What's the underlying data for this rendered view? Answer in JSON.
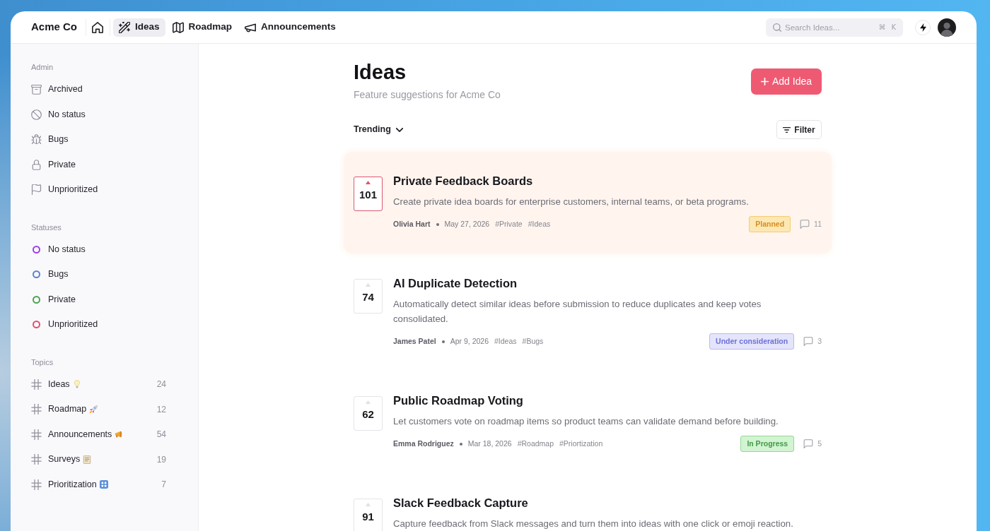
{
  "topbar": {
    "brand": "Acme Co",
    "tabs": [
      {
        "label": "Ideas",
        "selected": true
      },
      {
        "label": "Roadmap",
        "selected": false
      },
      {
        "label": "Announcements",
        "selected": false
      }
    ],
    "search": {
      "placeholder": "Search Ideas...",
      "shortcut": [
        "⌘",
        "K"
      ]
    }
  },
  "sidebar": {
    "sections": [
      {
        "title": "Admin",
        "kind": "icons",
        "items": [
          {
            "label": "Archived"
          },
          {
            "label": "No status"
          },
          {
            "label": "Bugs"
          },
          {
            "label": "Private"
          },
          {
            "label": "Unprioritized"
          }
        ]
      },
      {
        "title": "Statuses",
        "kind": "statuses",
        "items": [
          {
            "label": "No status",
            "color": "#9b40e8"
          },
          {
            "label": "Bugs",
            "color": "#5d80d2"
          },
          {
            "label": "Private",
            "color": "#4fa152"
          },
          {
            "label": "Unprioritized",
            "color": "#e2506d"
          }
        ]
      },
      {
        "title": "Topics",
        "kind": "topics",
        "items": [
          {
            "label": "Ideas",
            "count": "24"
          },
          {
            "label": "Roadmap",
            "count": "12"
          },
          {
            "label": "Announcements",
            "count": "54"
          },
          {
            "label": "Surveys",
            "count": "19"
          },
          {
            "label": "Prioritization",
            "count": "7"
          }
        ]
      }
    ]
  },
  "page": {
    "title": "Ideas",
    "subtitle": "Feature suggestions for Acme Co",
    "add_button": "Add Idea",
    "sort": "Trending",
    "filter_button": "Filter"
  },
  "ideas": [
    {
      "votes": "101",
      "voted": true,
      "highlighted": true,
      "title": "Private Feedback Boards",
      "description": "Create private idea boards for enterprise customers, internal teams, or beta programs.",
      "author": "Olivia Hart",
      "date": "May 27, 2026",
      "tags": [
        "#Private",
        "#Ideas"
      ],
      "status": {
        "label": "Planned",
        "kind": "planned"
      },
      "comments": "11"
    },
    {
      "votes": "74",
      "voted": false,
      "highlighted": false,
      "title": "AI Duplicate Detection",
      "description": "Automatically detect similar ideas before submission to reduce duplicates and keep votes consolidated.",
      "author": "James Patel",
      "date": "Apr 9, 2026",
      "tags": [
        "#Ideas",
        "#Bugs"
      ],
      "status": {
        "label": "Under consideration",
        "kind": "under_consideration"
      },
      "comments": "3"
    },
    {
      "votes": "62",
      "voted": false,
      "highlighted": false,
      "title": "Public Roadmap Voting",
      "description": "Let customers vote on roadmap items so product teams can validate demand before building.",
      "author": "Emma Rodriguez",
      "date": "Mar 18, 2026",
      "tags": [
        "#Roadmap",
        "#Priortization"
      ],
      "status": {
        "label": "In Progress",
        "kind": "in_progress"
      },
      "comments": "5"
    },
    {
      "votes": "91",
      "voted": false,
      "highlighted": false,
      "title": "Slack Feedback Capture",
      "description": "Capture feedback from Slack messages and turn them into ideas with one click or emoji reaction."
    }
  ]
}
